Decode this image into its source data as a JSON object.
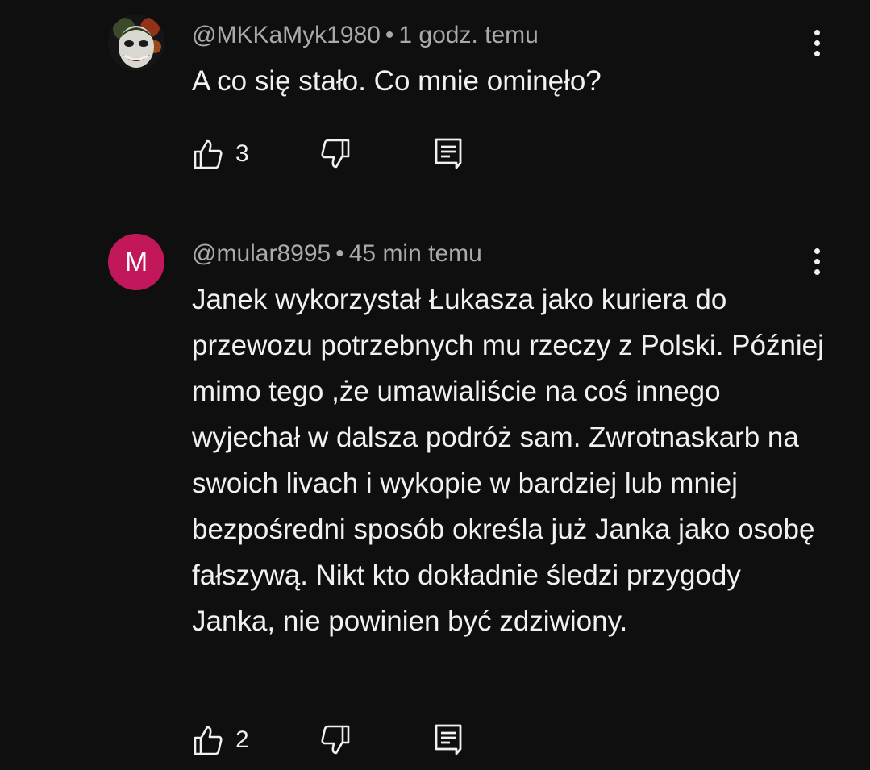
{
  "comments": [
    {
      "author": "@MKKaMyk1980",
      "separator": "•",
      "time": "1 godz. temu",
      "text": "A co się stało. Co mnie ominęło?",
      "likes": "3",
      "avatar_icon": "joker-face-icon"
    },
    {
      "author": "@mular8995",
      "separator": "•",
      "time": "45 min temu",
      "text": "Janek wykorzystał Łukasza jako kuriera do przewozu potrzebnych mu rzeczy z Polski. Później mimo tego ,że umawialiście na coś innego wyjechał w dalsza podróż sam. Zwrotnaskarb na swoich livach i wykopie w bardziej lub mniej bezpośredni sposób określa już Janka jako osobę fałszywą. Nikt kto dokładnie śledzi przygody Janka, nie powinien być zdziwiony.",
      "likes": "2",
      "avatar_letter": "M",
      "avatar_color": "#c2185b"
    }
  ],
  "colors": {
    "background": "#0f0f0f",
    "primary_text": "#f1f1f1",
    "secondary_text": "#aaaaaa"
  }
}
